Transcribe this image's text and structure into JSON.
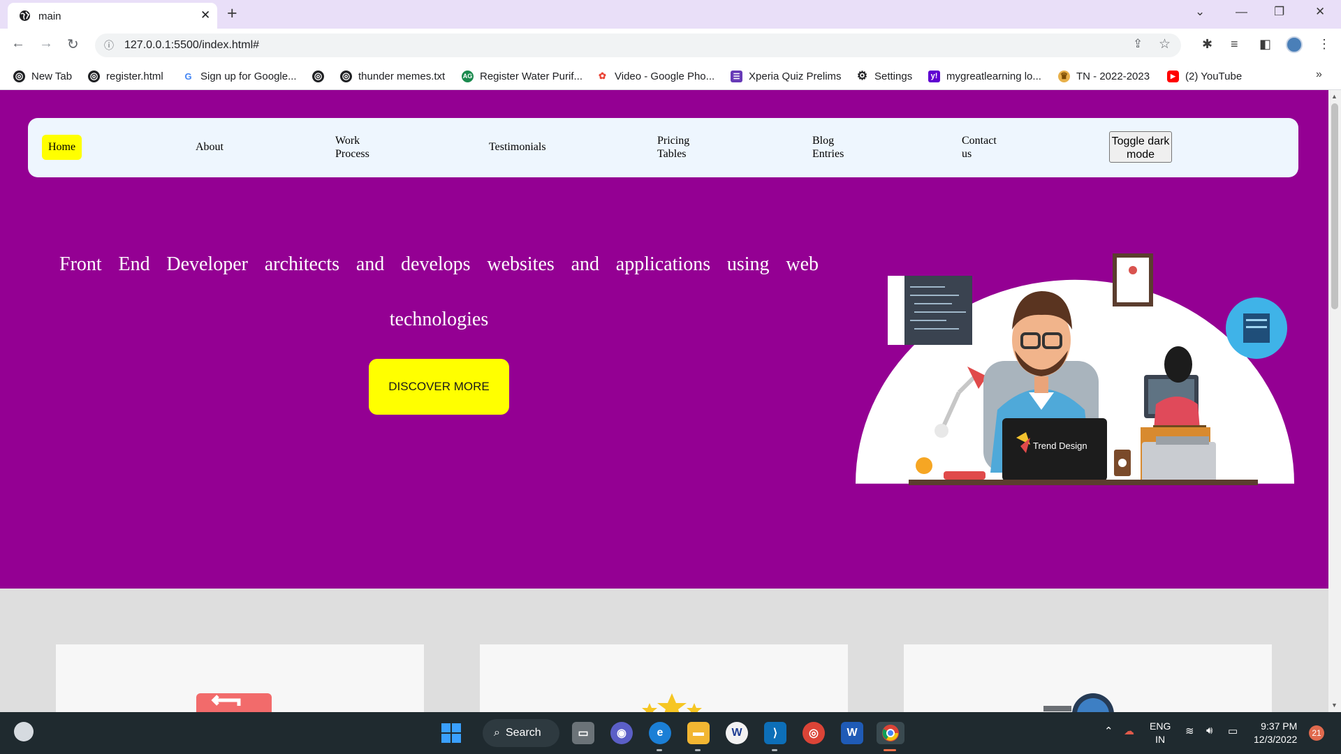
{
  "browser": {
    "tab_title": "main",
    "url": "127.0.0.1:5500/index.html#",
    "bookmarks": [
      {
        "label": "New Tab",
        "icon": "globe-icon"
      },
      {
        "label": "register.html",
        "icon": "globe-icon"
      },
      {
        "label": "Sign up for Google...",
        "icon": "google-icon"
      },
      {
        "label": "",
        "icon": "globe-icon"
      },
      {
        "label": "thunder memes.txt",
        "icon": "globe-icon"
      },
      {
        "label": "Register Water Purif...",
        "icon": "aquaguard-icon"
      },
      {
        "label": "Video - Google Pho...",
        "icon": "google-photos-icon"
      },
      {
        "label": "Xperia Quiz Prelims",
        "icon": "forms-icon"
      },
      {
        "label": "Settings",
        "icon": "gear-icon"
      },
      {
        "label": "mygreatlearning lo...",
        "icon": "yahoo-icon"
      },
      {
        "label": "TN - 2022-2023",
        "icon": "emblem-icon"
      },
      {
        "label": "(2) YouTube",
        "icon": "youtube-icon"
      }
    ]
  },
  "page": {
    "nav": {
      "home": "Home",
      "about": "About",
      "work_process": "Work Process",
      "testimonials": "Testimonials",
      "pricing": "Pricing Tables",
      "blog": "Blog Entries",
      "contact": "Contact us",
      "toggle": "Toggle dark mode"
    },
    "hero": {
      "headline": "Front End Developer architects and develops websites and applications using web technologies",
      "cta": "DISCOVER MORE",
      "illustration_label": "Trend Design"
    },
    "colors": {
      "hero_bg": "#940093",
      "highlight": "#ffff00",
      "navbar_bg": "#eef6fe",
      "features_bg": "#dedede"
    }
  },
  "taskbar": {
    "search_label": "Search",
    "language": "ENG",
    "region": "IN",
    "time": "9:37 PM",
    "date": "12/3/2022",
    "notifications": "21"
  }
}
